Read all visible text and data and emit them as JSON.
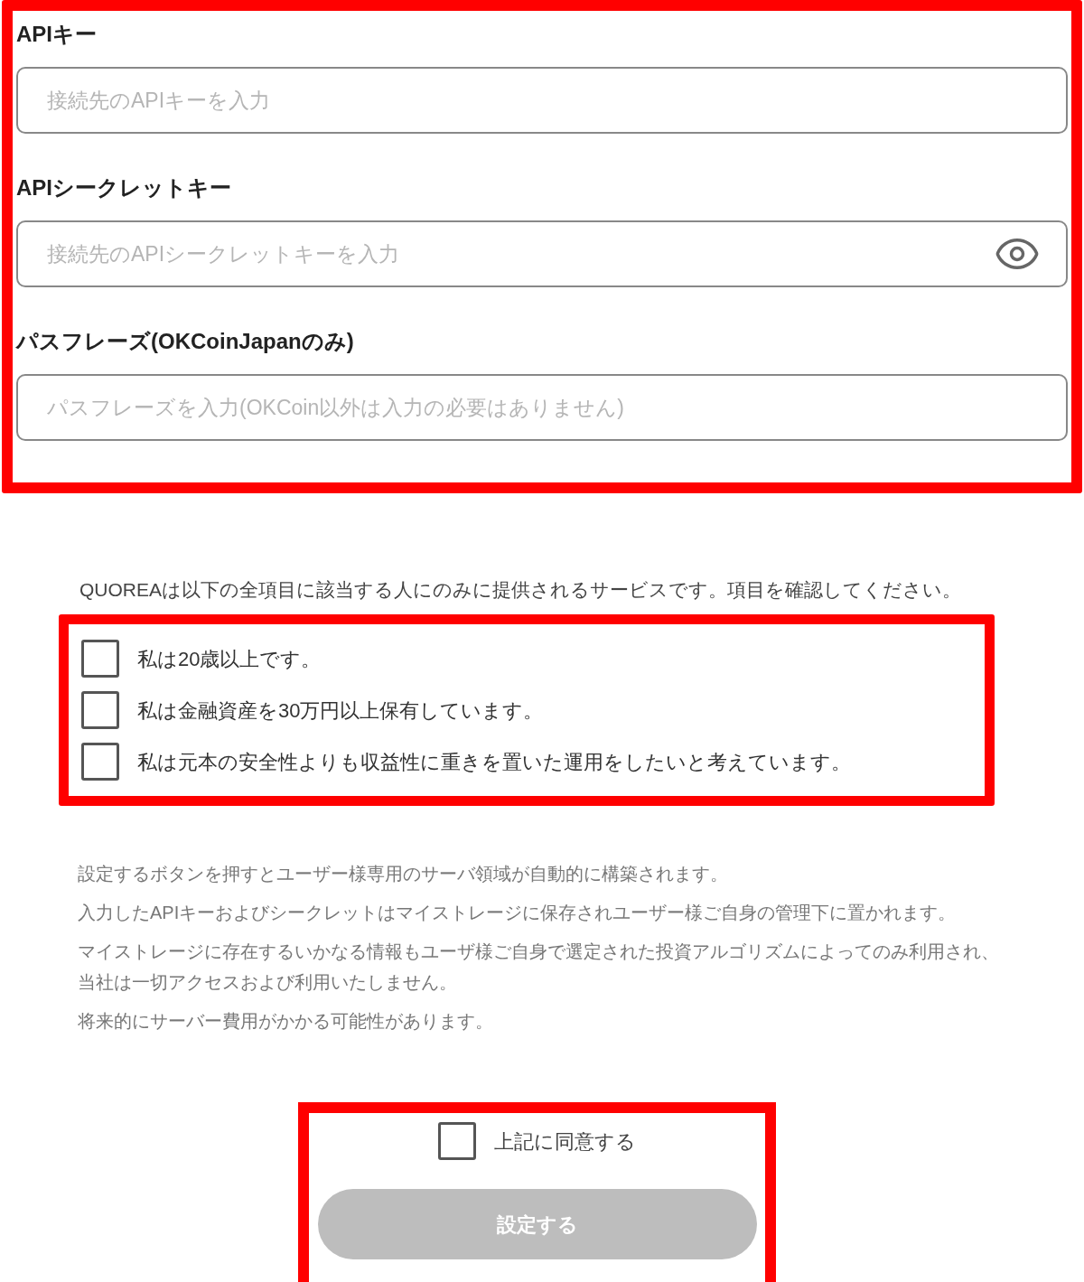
{
  "fields": [
    {
      "label": "APIキー",
      "placeholder": "接続先のAPIキーを入力",
      "reveal_toggle": false
    },
    {
      "label": "APIシークレットキー",
      "placeholder": "接続先のAPIシークレットキーを入力",
      "reveal_toggle": true
    },
    {
      "label": "パスフレーズ(OKCoinJapanのみ)",
      "placeholder": "パスフレーズを入力(OKCoin以外は入力の必要はありません)",
      "reveal_toggle": false
    }
  ],
  "notice": "QUOREAは以下の全項目に該当する人にのみに提供されるサービスです。項目を確認してください。",
  "conditions": [
    {
      "label": "私は20歳以上です。",
      "checked": false
    },
    {
      "label": "私は金融資産を30万円以上保有しています。",
      "checked": false
    },
    {
      "label": "私は元本の安全性よりも収益性に重きを置いた運用をしたいと考えています。",
      "checked": false
    }
  ],
  "notes": [
    "設定するボタンを押すとユーザー様専用のサーバ領域が自動的に構築されます。",
    "入力したAPIキーおよびシークレットはマイストレージに保存されユーザー様ご自身の管理下に置かれます。",
    "マイストレージに存在するいかなる情報もユーザ様ご自身で選定された投資アルゴリズムによってのみ利用され、当社は一切アクセスおよび利用いたしません。",
    "将来的にサーバー費用がかかる可能性があります。"
  ],
  "agree": {
    "label": "上記に同意する",
    "checked": false
  },
  "submit": {
    "label": "設定する",
    "disabled": true
  }
}
